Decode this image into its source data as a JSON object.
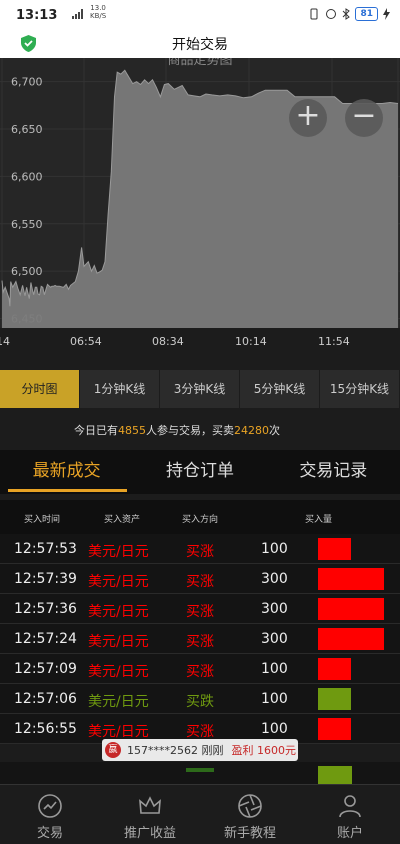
{
  "status_bar": {
    "time": "13:13",
    "speed_value": "13.0",
    "speed_unit": "KB/S",
    "battery": "81"
  },
  "header": {
    "title": "开始交易"
  },
  "chart_data": {
    "type": "line",
    "title": "商品走势图",
    "y_ticks": [
      "6,700",
      "6,650",
      "6,600",
      "6,550",
      "6,500",
      "6,450"
    ],
    "x_ticks": [
      "14",
      "06:54",
      "08:34",
      "10:14",
      "11:54"
    ],
    "ylim": [
      6440,
      6725
    ],
    "color": "#7a7a7a",
    "x": [
      0,
      0.3,
      0.8,
      1.8,
      2,
      2.2,
      2.7,
      3.5,
      4,
      4.6,
      5.2,
      5.8,
      6.2,
      6.9,
      7.3,
      7.7,
      8,
      8.4,
      8.8,
      9.1,
      9.5,
      9.9,
      10.3,
      10.7,
      11.1,
      11.5,
      12,
      12.3,
      12.6,
      13,
      13.4,
      13.8,
      14.5,
      15.5,
      16.2,
      16.8,
      17.3,
      18.5,
      19.3,
      20.1,
      20.7,
      21.8,
      22.6,
      23.3,
      24,
      24.6,
      25.3,
      26,
      26.8,
      27.6,
      28.4,
      29.1,
      30,
      31,
      32,
      33,
      34,
      35,
      36,
      37,
      38,
      39,
      40,
      41,
      42,
      43.5,
      45.5,
      47,
      48.5,
      50,
      51.5,
      53,
      55,
      57,
      59,
      61,
      63,
      64.8,
      66.5,
      68.5,
      70,
      72,
      74,
      76,
      78,
      80,
      82,
      84,
      86,
      88,
      90,
      92,
      94,
      96,
      98,
      100
    ],
    "y": [
      6490,
      6478,
      6483,
      6471,
      6463,
      6489,
      6483,
      6489,
      6482,
      6475,
      6485,
      6474,
      6483,
      6471,
      6488,
      6480,
      6475,
      6483,
      6483,
      6476,
      6475,
      6484,
      6483,
      6475,
      6481,
      6486,
      6484,
      6483,
      6484,
      6484,
      6485,
      6484,
      6484,
      6483,
      6486,
      6481,
      6485,
      6489,
      6500,
      6525,
      6505,
      6510,
      6500,
      6506,
      6498,
      6499,
      6501,
      6510,
      6560,
      6605,
      6684,
      6710,
      6708,
      6712,
      6705,
      6698,
      6700,
      6697,
      6702,
      6698,
      6702,
      6694,
      6684,
      6697,
      6698,
      6692,
      6696,
      6686,
      6685,
      6684,
      6687,
      6686,
      6685,
      6686,
      6685,
      6683,
      6684,
      6688,
      6691,
      6691,
      6691,
      6691,
      6684,
      6684,
      6684,
      6684,
      6684,
      6684,
      6677,
      6677,
      6677,
      6677,
      6677,
      6677,
      6678,
      6677
    ]
  },
  "kline_tabs": [
    "分时图",
    "1分钟K线",
    "3分钟K线",
    "5分钟K线",
    "15分钟K线"
  ],
  "notice": {
    "prefix": "今日已有",
    "participants": "4855",
    "middle": "人参与交易，买卖",
    "trades": "24280",
    "suffix": "次"
  },
  "section_tabs": [
    "最新成交",
    "持仓订单",
    "交易记录"
  ],
  "table": {
    "headers": [
      "买入时间",
      "买入资产",
      "买入方向",
      "买入量"
    ],
    "rows": [
      {
        "time": "12:57:53",
        "asset": "美元/日元",
        "direction": "买涨",
        "qty": "100",
        "color": "#ff0000"
      },
      {
        "time": "12:57:39",
        "asset": "美元/日元",
        "direction": "买涨",
        "qty": "300",
        "color": "#ff0000"
      },
      {
        "time": "12:57:36",
        "asset": "美元/日元",
        "direction": "买涨",
        "qty": "300",
        "color": "#ff0000"
      },
      {
        "time": "12:57:24",
        "asset": "美元/日元",
        "direction": "买涨",
        "qty": "300",
        "color": "#ff0000"
      },
      {
        "time": "12:57:09",
        "asset": "美元/日元",
        "direction": "买涨",
        "qty": "100",
        "color": "#ff0000"
      },
      {
        "time": "12:57:06",
        "asset": "美元/日元",
        "direction": "买跌",
        "qty": "100",
        "color": "#6f9a10"
      },
      {
        "time": "12:56:55",
        "asset": "美元/日元",
        "direction": "买涨",
        "qty": "100",
        "color": "#ff0000"
      }
    ]
  },
  "popup": {
    "logo": "嬴",
    "user": "157****2562 刚刚",
    "profit": "盈利 1600元"
  },
  "bottom_nav": [
    "交易",
    "推广收益",
    "新手教程",
    "账户"
  ]
}
